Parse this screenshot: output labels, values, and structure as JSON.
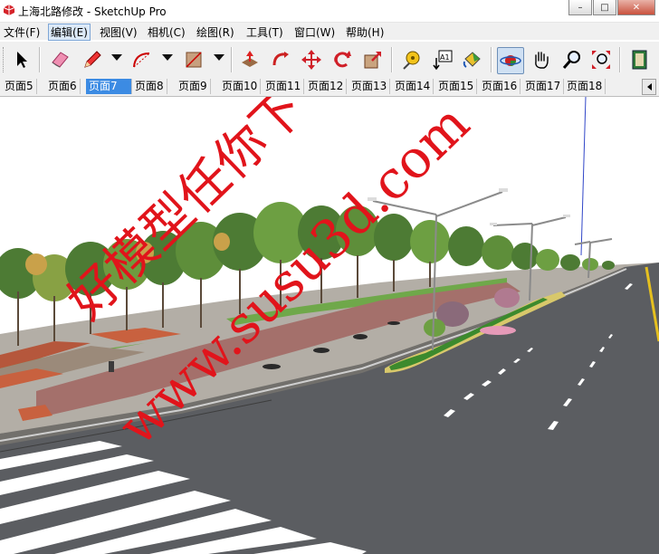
{
  "window": {
    "title": "上海北路修改 - SketchUp Pro",
    "minimize": "–",
    "maximize": "□",
    "close": "✕"
  },
  "menu": [
    "文件(F)",
    "编辑(E)",
    "视图(V)",
    "相机(C)",
    "绘图(R)",
    "工具(T)",
    "窗口(W)",
    "帮助(H)"
  ],
  "menu_active": "编辑(E)",
  "toolbar": {
    "tools": [
      "select",
      "eraser",
      "pencil",
      "arc",
      "rectangle",
      "push-pull",
      "follow-me",
      "move",
      "rotate",
      "scale",
      "tape-measure",
      "text",
      "paint-bucket",
      "orbit",
      "pan",
      "zoom",
      "zoom-extents",
      "component"
    ],
    "active_tool": "orbit",
    "text_tool_label": "A1"
  },
  "scene_tabs": [
    "页面5",
    "页面6",
    "页面7",
    "页面8",
    "页面9",
    "页面10",
    "页面11",
    "页面12",
    "页面13",
    "页面14",
    "页面15",
    "页面16",
    "页面17",
    "页面18"
  ],
  "active_scene_tab": "页面7",
  "watermark": {
    "line1": "好模型任你下",
    "line2": "www.susu3d.com",
    "color": "#e1141b"
  },
  "colors": {
    "sky": "#ffffff",
    "road": "#5b5d61",
    "lane_marking": "#ffffff",
    "tab_highlight": "#3c8be3"
  }
}
